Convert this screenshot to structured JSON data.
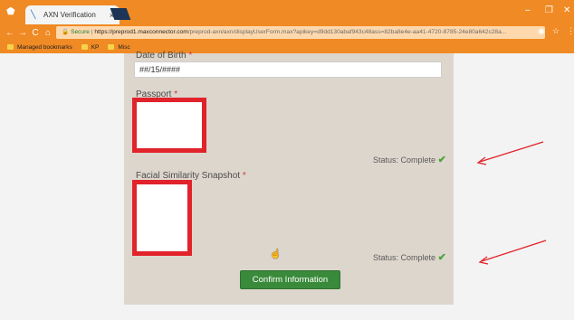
{
  "browser": {
    "tab_title": "AXN Verification",
    "tab_close": "×",
    "url_secure": "Secure",
    "url_host": "https://preprod1.maxconnector.com",
    "url_path": "/preprod-axn/axn/displayUserForm.max?apikey=d9dd130abaf943c48ass=82ba8e4e-aa41-4720-8785-24e80a642c28a...",
    "bookmarks": [
      "Managed bookmarks",
      "KP",
      "Misc"
    ]
  },
  "form": {
    "dob_label": "Date of Birth",
    "dob_value": "##/15/####",
    "passport_label": "Passport",
    "passport_status": "Status: Complete",
    "facial_label": "Facial Similarity Snapshot",
    "facial_status": "Status: Complete",
    "required_mark": "*",
    "confirm_label": "Confirm Information"
  },
  "colors": {
    "accent_chrome": "#f08a24",
    "highlight_box": "#e1232b",
    "status_check": "#4aa23a",
    "confirm_button": "#3a8a3b"
  }
}
